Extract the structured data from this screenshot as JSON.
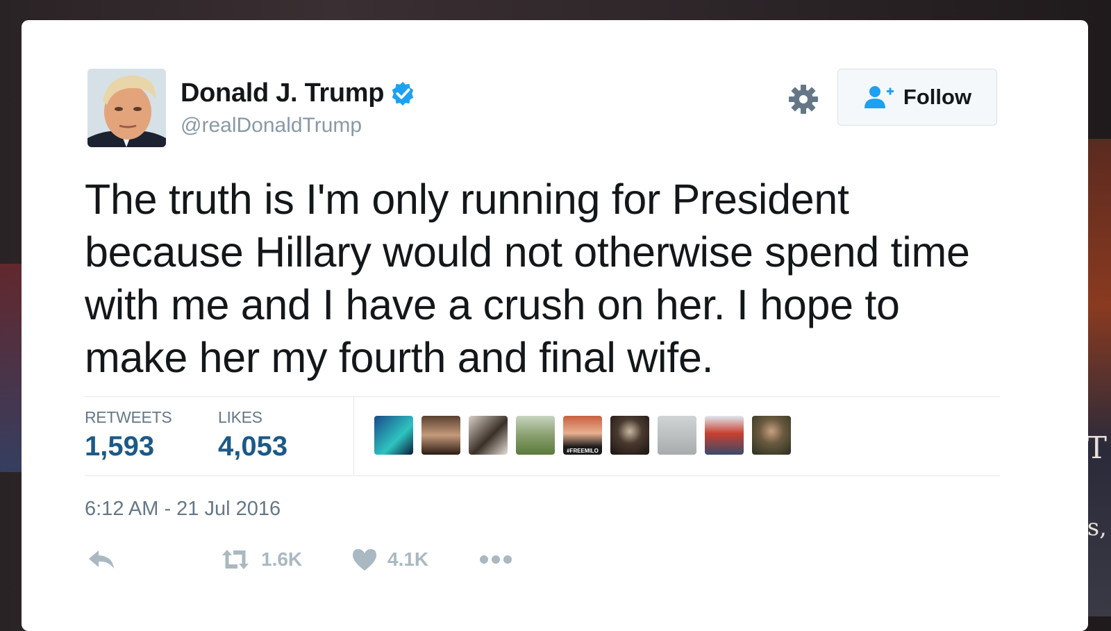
{
  "tweet": {
    "author_name": "Donald J. Trump",
    "author_handle": "@realDonaldTrump",
    "follow_label": "Follow",
    "text": "The truth is I'm only running for President because Hillary would not otherwise spend time with me and I have a crush on her. I hope to make her my fourth and final wife.",
    "retweets_label": "RETWEETS",
    "retweets_value": "1,593",
    "likes_label": "LIKES",
    "likes_value": "4,053",
    "timestamp": "6:12 AM - 21 Jul 2016",
    "actions": {
      "retweet_count": "1.6K",
      "like_count": "4.1K"
    },
    "liker_avatar_caption": "#FREEMILO"
  },
  "colors": {
    "verified": "#1da1f2",
    "link_blue": "#1b5a87",
    "icon_grey": "#aab8c2",
    "secondary_text": "#657786"
  },
  "icons": [
    "verified-badge-icon",
    "gear-icon",
    "follow-person-icon",
    "reply-icon",
    "retweet-icon",
    "heart-icon",
    "more-icon"
  ],
  "background": {
    "letter_1": "T",
    "letter_2": "s,"
  }
}
